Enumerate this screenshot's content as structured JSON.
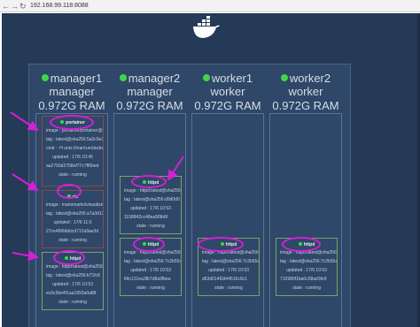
{
  "browser": {
    "url": "192.168.99.118:8088",
    "back_icon": "arrow-left-icon",
    "forward_icon": "arrow-right-icon",
    "reload_icon": "reload-icon"
  },
  "logo": "docker-whale-logo",
  "nodes": [
    {
      "name": "manager1",
      "role": "manager",
      "ram": "0.972G RAM",
      "services": [
        {
          "title": "portainer",
          "image": "image : portainer/portainer@sha256:",
          "tag": "tag : latest@sha256:5a2c9a3b",
          "cmd": "cmd : -H unix:///var/run/docker.sock",
          "id": "aa2793d2758ef77c7ff0bed",
          "updated": "updated : 17/6 10:45",
          "state": "state : running"
        },
        {
          "title": "viz",
          "image": "image : manomarks/visualizer@sha",
          "tag": "tag : latest@sha256:a7a3d13",
          "updated": "updated : 17/6 11:0",
          "id": "27ce4f96bbbcd712a9ae3d",
          "state": "state : running"
        },
        {
          "title": "httpd",
          "image": "image : httpd:latest@sha256:",
          "tag": "tag : latest@sha256:b71fc8",
          "updated": "updated : 17/6 10:53",
          "id": "ec0c3be4f1aa1893a0a88",
          "state": "state : running"
        }
      ]
    },
    {
      "name": "manager2",
      "role": "manager",
      "ram": "0.972G RAM",
      "services": [
        {
          "title": "httpd",
          "image": "image : httpd:latest@sha256:",
          "tag": "tag : latest@sha256:d0d0d0",
          "updated": "updated : 17/6 10:53",
          "id": "1158842cc48ea5f9b6f",
          "state": "state : running"
        },
        {
          "title": "httpd",
          "image": "image : httpd:latest@sha256:",
          "tag": "tag : latest@sha256:7c2b55a7a",
          "updated": "updated : 17/6 10:53",
          "id": "84c131ea3fb7d8a9fbea",
          "state": "state : running"
        }
      ]
    },
    {
      "name": "worker1",
      "role": "worker",
      "ram": "0.972G RAM",
      "services": [
        {
          "title": "httpd",
          "image": "image : httpd:latest@sha256:",
          "tag": "tag : latest@sha256:7c2b55a7a",
          "updated": "updated : 17/6 10:53",
          "id": "d63d014f2d44516c9c1",
          "state": "state : running"
        }
      ]
    },
    {
      "name": "worker2",
      "role": "worker",
      "ram": "0.972G RAM",
      "services": [
        {
          "title": "httpd",
          "image": "image : httpd:latest@sha256:",
          "tag": "tag : latest@sha256:7c2b55a7a",
          "updated": "updated : 17/6 10:53",
          "id": "710980f1ba0c58ad3fe9",
          "state": "state : running"
        }
      ]
    }
  ],
  "colors": {
    "background": "#243a57",
    "panel": "#2f4768",
    "online_dot": "#3fd64a",
    "annotation": "#d61fd6"
  }
}
